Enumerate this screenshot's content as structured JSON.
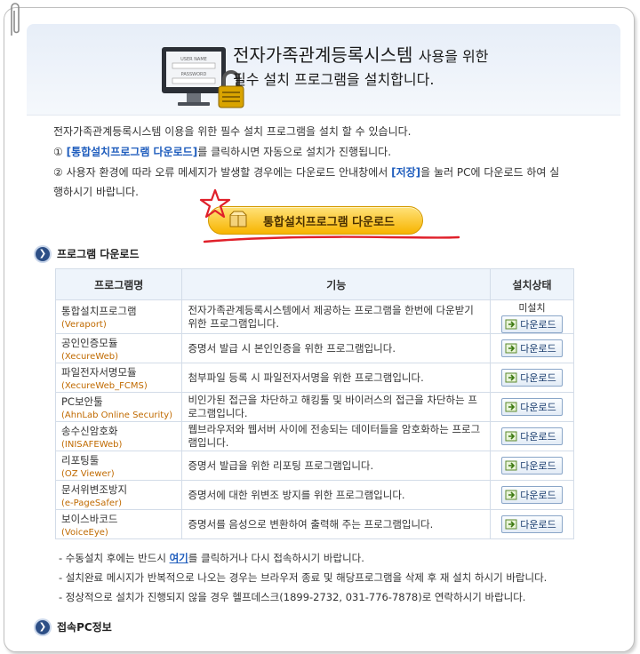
{
  "header": {
    "title_main": "전자가족관계등록시스템",
    "title_suffix": "사용을 위한",
    "title_line2": "필수 설치 프로그램을 설치합니다.",
    "monitor_label1": "USER NAME",
    "monitor_label2": "PASSWORD"
  },
  "intro": {
    "line1": "전자가족관계등록시스템 이용을 위한 필수 설치 프로그램을 설치 할 수 있습니다.",
    "line2_prefix": "① ",
    "line2_link": "[통합설치프로그램 다운로드]",
    "line2_suffix": "를 클릭하시면 자동으로 설치가 진행됩니다.",
    "line3_prefix": "② 사용자 환경에 따라 오류 메세지가 발생할 경우에는 다운로드 안내창에서 ",
    "line3_link": "[저장]",
    "line3_suffix": "을 눌러 PC에 다운로드 하여 실",
    "line4": "행하시기 바랍니다."
  },
  "main_download_button": "통합설치프로그램 다운로드",
  "section_download": {
    "title": "프로그램 다운로드"
  },
  "table": {
    "headers": [
      "프로그램명",
      "기능",
      "설치상태"
    ],
    "download_label": "다운로드",
    "rows": [
      {
        "name": "통합설치프로그램",
        "name_en": "(Veraport)",
        "func": "전자가족관계등록시스템에서 제공하는 프로그램을 한번에 다운받기 위한 프로그램입니다.",
        "status": "미설치"
      },
      {
        "name": "공인인증모듈",
        "name_en": "(XecureWeb)",
        "func": "증명서 발급 시 본인인증을 위한 프로그램입니다.",
        "status": ""
      },
      {
        "name": "파일전자서명모듈",
        "name_en": "(XecureWeb_FCMS)",
        "func": "첨부파일 등록 시 파일전자서명을 위한 프로그램입니다.",
        "status": ""
      },
      {
        "name": "PC보안툴",
        "name_en": "(AhnLab Online Security)",
        "func": "비인가된 접근을 차단하고 해킹툴 및 바이러스의 접근을 차단하는 프로그램입니다.",
        "status": ""
      },
      {
        "name": "송수신암호화",
        "name_en": "(INISAFEWeb)",
        "func": "웹브라우저와 웹서버 사이에 전송되는 데이터들을 암호화하는 프로그램입니다.",
        "status": ""
      },
      {
        "name": "리포팅툴",
        "name_en": "(OZ Viewer)",
        "func": "증명서 발급을 위한 리포팅 프로그램입니다.",
        "status": ""
      },
      {
        "name": "문서위변조방지",
        "name_en": "(e-PageSafer)",
        "func": "증명서에 대한 위변조 방지를 위한 프로그램입니다.",
        "status": ""
      },
      {
        "name": "보이스바코드",
        "name_en": "(VoiceEye)",
        "func": "증명서를 음성으로 변환하여 출력해 주는 프로그램입니다.",
        "status": ""
      }
    ]
  },
  "notes": {
    "note1_prefix": "- 수동설치 후에는 반드시 ",
    "note1_link": "여기",
    "note1_suffix": "를 클릭하거나 다시 접속하시기 바랍니다.",
    "note2": "- 설치완료 메시지가 반복적으로 나오는 경우는 브라우저 종료 및 해당프로그램을 삭제 후 재 설치 하시기 바랍니다.",
    "note3": "- 정상적으로 설치가 진행되지 않을 경우 헬프데스크(1899-2732, 031-776-7878)로 연락하시기 바랍니다."
  },
  "section_pcinfo": {
    "title": "접속PC정보"
  },
  "colors": {
    "accent": "#1f5dbd",
    "button": "#f7b400",
    "header_bg": "#e7eef8"
  }
}
